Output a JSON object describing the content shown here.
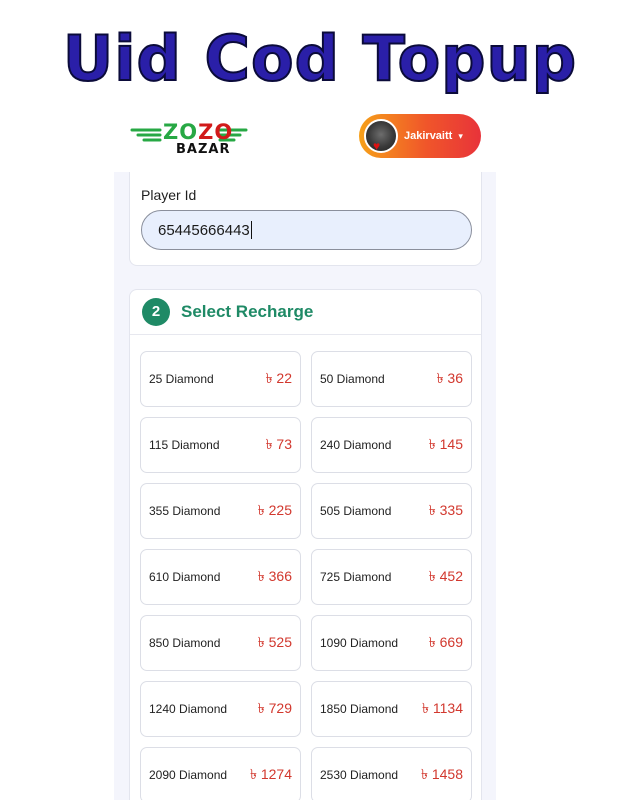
{
  "banner": {
    "title": "Uid Cod Topup"
  },
  "header": {
    "logo_top_1": "ZO",
    "logo_top_2": "ZO",
    "logo_bottom": "BAZAR",
    "user_name": "Jakirvaitt"
  },
  "colors": {
    "brand_green": "#1f8a66",
    "price_red": "#d2382e",
    "title_blue": "#2a1fa8",
    "pill_orange": "#f0562a"
  },
  "player": {
    "label": "Player Id",
    "value": "65445666443"
  },
  "recharge": {
    "step_number": "2",
    "title": "Select Recharge",
    "items": [
      {
        "name": "25 Diamond",
        "price": "৳ 22"
      },
      {
        "name": "50 Diamond",
        "price": "৳ 36"
      },
      {
        "name": "115 Diamond",
        "price": "৳ 73"
      },
      {
        "name": "240 Diamond",
        "price": "৳ 145"
      },
      {
        "name": "355 Diamond",
        "price": "৳ 225"
      },
      {
        "name": "505 Diamond",
        "price": "৳ 335"
      },
      {
        "name": "610 Diamond",
        "price": "৳ 366"
      },
      {
        "name": "725 Diamond",
        "price": "৳ 452"
      },
      {
        "name": "850 Diamond",
        "price": "৳ 525"
      },
      {
        "name": "1090 Diamond",
        "price": "৳ 669"
      },
      {
        "name": "1240 Diamond",
        "price": "৳ 729"
      },
      {
        "name": "1850 Diamond",
        "price": "৳ 1134"
      },
      {
        "name": "2090 Diamond",
        "price": "৳ 1274"
      },
      {
        "name": "2530 Diamond",
        "price": "৳ 1458"
      }
    ]
  }
}
